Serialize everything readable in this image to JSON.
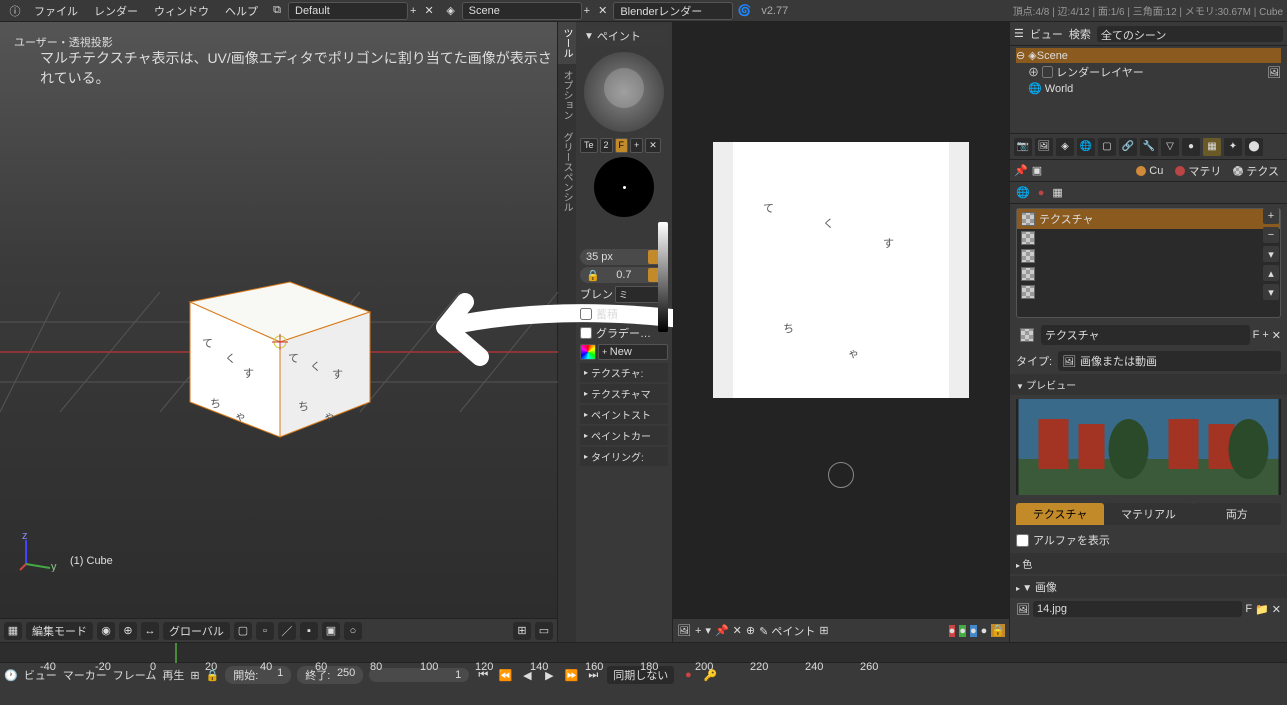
{
  "topbar": {
    "menus": [
      "ファイル",
      "レンダー",
      "ウィンドウ",
      "ヘルプ"
    ],
    "layout": "Default",
    "scene": "Scene",
    "engine": "Blenderレンダー",
    "version": "v2.77",
    "stats": "頂点:4/8 | 辺:4/12 | 面:1/6 | 三角面:12 | メモリ:30.67M | Cube"
  },
  "viewport3d": {
    "persp_label": "ユーザー・透視投影",
    "overlay_text": "マルチテクスチャ表示は、UV/画像エディタでポリゴンに割り当てた画像が表示されている。",
    "object_label": "(1) Cube",
    "header": {
      "mode": "編集モード",
      "orientation": "グローバル"
    }
  },
  "paint_panel": {
    "title": "ペイント",
    "tabs": [
      "ツール",
      "オプション",
      "グリースペンシル"
    ],
    "tex_btn": "Te",
    "num_btn": "2",
    "f_btn": "F",
    "radius": {
      "label": "",
      "value": "35 px"
    },
    "strength": {
      "value": "0.7"
    },
    "blend_label": "ブレン",
    "blend_mode": "ミ",
    "accumulate": "蓄積",
    "gradient": "グラデー…",
    "new_btn": "New",
    "sub_panels": [
      "テクスチャ:",
      "テクスチャマ",
      "ペイントスト",
      "ペイントカー",
      "タイリング:"
    ]
  },
  "image_editor": {
    "header_mode": "ペイント"
  },
  "outliner": {
    "view": "ビュー",
    "search": "検索",
    "filter": "全てのシーン",
    "items": [
      {
        "label": "Scene",
        "sel": true,
        "icon": "scene"
      },
      {
        "label": "レンダーレイヤー",
        "icon": "layers",
        "indent": 1
      },
      {
        "label": "World",
        "icon": "world",
        "indent": 1
      }
    ]
  },
  "properties": {
    "context_tabs": [
      {
        "label": "Cu",
        "color": "#d08a3a"
      },
      {
        "label": "マテリ",
        "color": "#b44"
      },
      {
        "label": "テクス",
        "checker": true
      }
    ],
    "texture_name": "テクスチャ",
    "datablock": "テクスチャ",
    "f": "F",
    "type_label": "タイプ:",
    "type_value": "画像または動画",
    "preview_label": "プレビュー",
    "tabs": [
      "テクスチャ",
      "マテリアル",
      "両方"
    ],
    "alpha_label": "アルファを表示",
    "color_panel": "色",
    "image_panel": "画像",
    "image_name": "14.jpg",
    "image_f": "F"
  },
  "timeline": {
    "ticks": [
      -40,
      -20,
      0,
      20,
      40,
      60,
      80,
      100,
      120,
      140,
      160,
      180,
      200,
      220,
      240,
      260
    ],
    "menus": [
      "ビュー",
      "マーカー",
      "フレーム",
      "再生"
    ],
    "start_label": "開始:",
    "start": 1,
    "end_label": "終了:",
    "end": 250,
    "current": 1,
    "sync": "同期しない"
  }
}
